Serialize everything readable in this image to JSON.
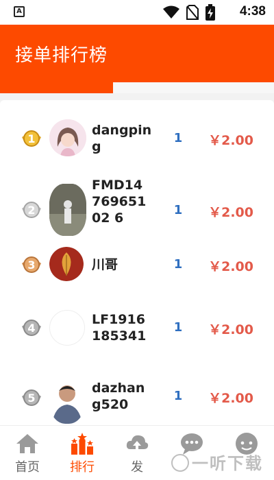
{
  "status_bar": {
    "app_badge": "A",
    "time": "4:38"
  },
  "header": {
    "title": "接单排行榜"
  },
  "ranking": [
    {
      "rank": "1",
      "name": "dangping",
      "count": "1",
      "amount": "￥2.00"
    },
    {
      "rank": "2",
      "name": "FMD1476965102 6",
      "count": "1",
      "amount": "￥2.00"
    },
    {
      "rank": "3",
      "name": "川哥",
      "count": "1",
      "amount": "￥2.00"
    },
    {
      "rank": "4",
      "name": "LF1916185341",
      "count": "1",
      "amount": "￥2.00"
    },
    {
      "rank": "5",
      "name": "dazhang520",
      "count": "1",
      "amount": "￥2.00"
    }
  ],
  "bottom_nav": [
    {
      "label": "首页",
      "icon": "home-icon"
    },
    {
      "label": "排行",
      "icon": "ranking-icon",
      "active": true
    },
    {
      "label": "发",
      "icon": "publish-icon"
    },
    {
      "label": "",
      "icon": "chat-icon"
    },
    {
      "label": "",
      "icon": "profile-icon"
    }
  ],
  "watermark": "一听下载",
  "colors": {
    "accent": "#fd4a00",
    "count": "#2f6fc0",
    "amount": "#e35a4a"
  }
}
